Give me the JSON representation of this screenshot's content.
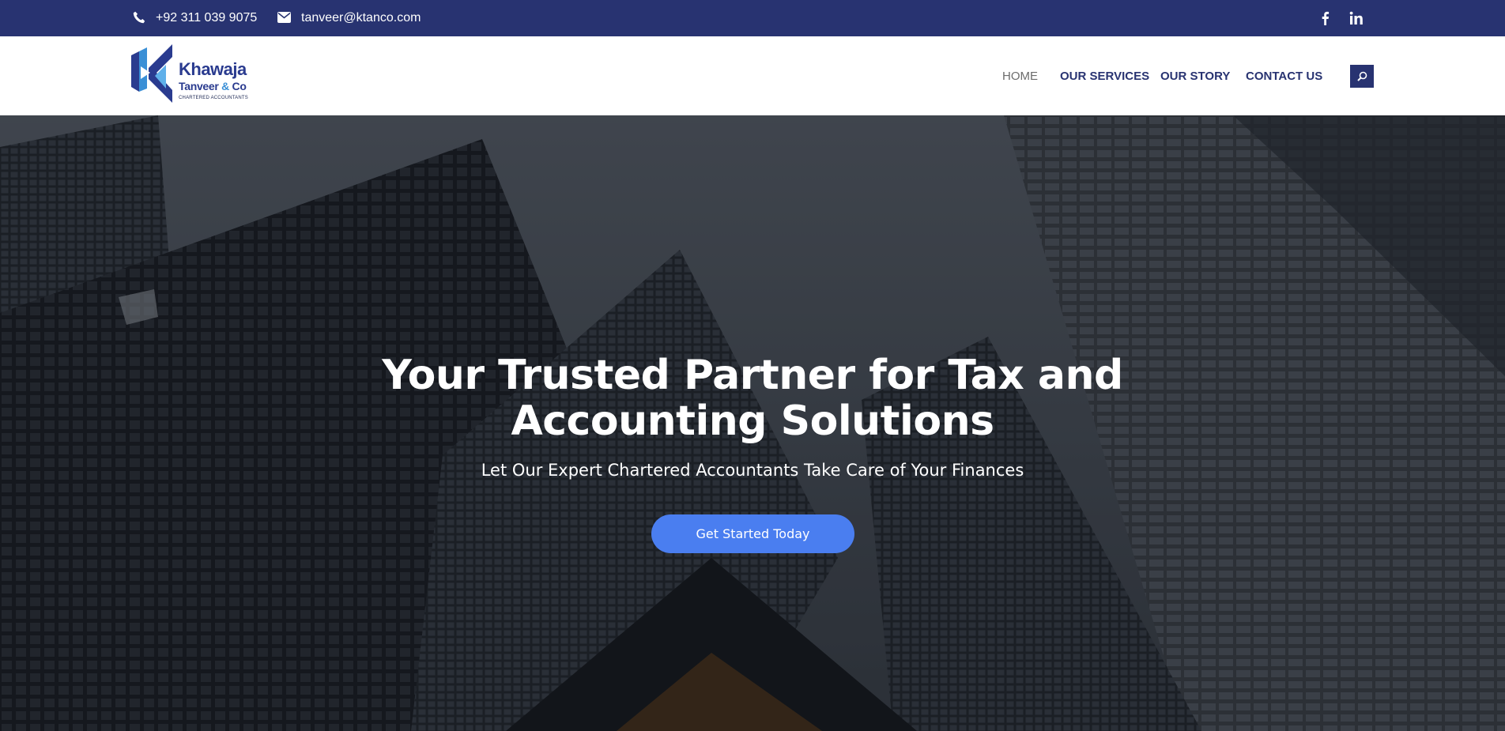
{
  "topbar": {
    "phone": "+92 311 039 9075",
    "email": "tanveer@ktanco.com",
    "social": [
      "facebook-icon",
      "linkedin-icon"
    ]
  },
  "logo": {
    "line1": "Khawaja",
    "line2a": "Tanveer ",
    "line2amp": "&",
    "line2b": " Co",
    "line3": "CHARTERED ACCOUNTANTS"
  },
  "nav": {
    "items": [
      {
        "label": "HOME"
      },
      {
        "label": "OUR SERVICES"
      },
      {
        "label": "OUR STORY"
      },
      {
        "label": "CONTACT US"
      }
    ]
  },
  "hero": {
    "title": "Your Trusted Partner for Tax and Accounting Solutions",
    "subtitle": "Let Our Expert Chartered Accountants Take Care of Your Finances",
    "cta_label": "Get Started Today"
  },
  "colors": {
    "topbar_bg": "#283371",
    "nav_text": "#283371",
    "cta_bg": "#4a7ef0"
  }
}
